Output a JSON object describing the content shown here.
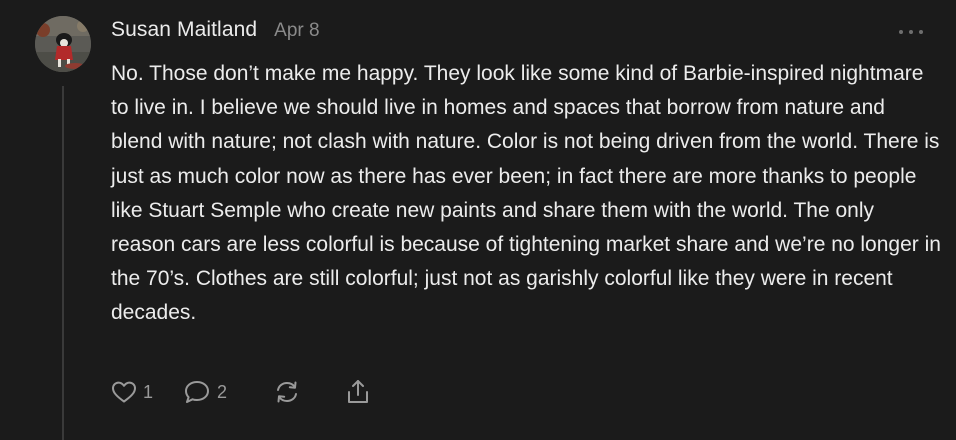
{
  "comment": {
    "author": "Susan Maitland",
    "date": "Apr 8",
    "body": "No. Those don’t make me happy. They look like some kind of Barbie-inspired nightmare to live in. I believe we should live in homes and spaces that borrow from nature and blend with nature; not clash with nature. Color is not being driven from the world. There is just as much color now as there has ever been; in fact there are more thanks to people like Stuart Semple who create new paints and share them with the world. The only reason cars are less colorful is because of tightening market share and we’re no longer in the 70’s. Clothes are still colorful; just not as garishly colorful like they were in recent decades.",
    "likes": "1",
    "replies": "2"
  },
  "icons": {
    "like": "heart-icon",
    "reply": "speech-bubble-icon",
    "restack": "restack-icon",
    "share": "share-icon",
    "more": "more-options-icon"
  },
  "colors": {
    "background": "#1b1b1b",
    "text": "#ececec",
    "muted": "#8a8a8a",
    "icon": "#9a9a9a"
  }
}
